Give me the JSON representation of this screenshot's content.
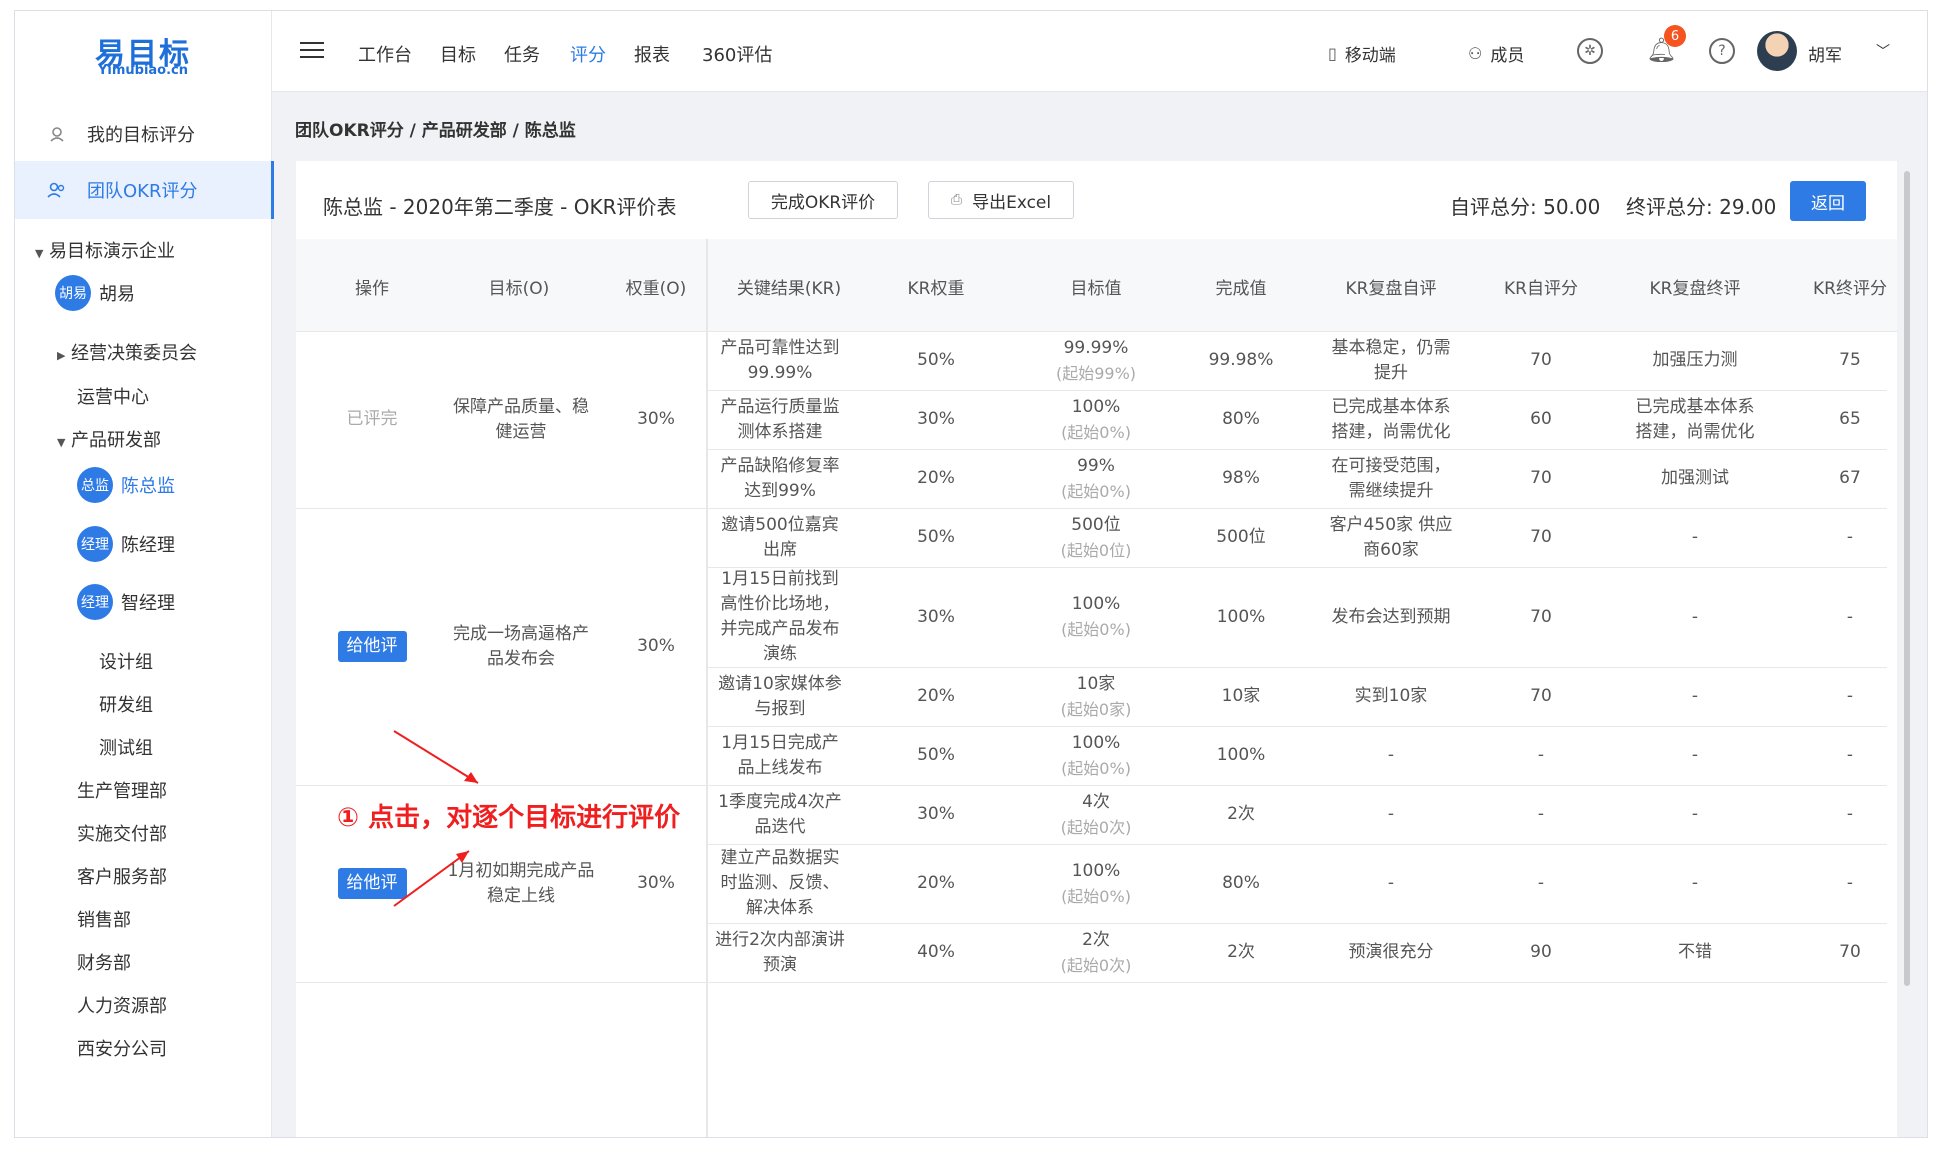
{
  "app": {
    "logo": "易目标",
    "logo_sub": "Yimubiao.cn"
  },
  "sidebar": {
    "my_score": "我的目标评分",
    "team_score": "团队OKR评分",
    "company": "易目标演示企业",
    "tree": [
      {
        "label": "胡易",
        "avatar": "胡易"
      },
      {
        "label": "经营决策委员会"
      },
      {
        "label": "运营中心"
      },
      {
        "label": "产品研发部"
      },
      {
        "label": "陈总监",
        "avatar": "总监"
      },
      {
        "label": "陈经理",
        "avatar": "经理"
      },
      {
        "label": "智经理",
        "avatar": "经理"
      },
      {
        "label": "设计组"
      },
      {
        "label": "研发组"
      },
      {
        "label": "测试组"
      },
      {
        "label": "生产管理部"
      },
      {
        "label": "实施交付部"
      },
      {
        "label": "客户服务部"
      },
      {
        "label": "销售部"
      },
      {
        "label": "财务部"
      },
      {
        "label": "人力资源部"
      },
      {
        "label": "西安分公司"
      }
    ]
  },
  "topnav": {
    "items": [
      "工作台",
      "目标",
      "任务",
      "评分",
      "报表",
      "360评估"
    ],
    "active": "评分"
  },
  "tools": {
    "mobile": "移动端",
    "members": "成员",
    "notifications": "6",
    "user": "胡军"
  },
  "breadcrumb": "团队OKR评分 / 产品研发部 / 陈总监",
  "card": {
    "title": "陈总监 - 2020年第二季度 - OKR评价表",
    "complete_btn": "完成OKR评价",
    "export_btn": "导出Excel",
    "self_total": "自评总分: 50.00",
    "final_total": "终评总分: 29.00",
    "back_btn": "返回"
  },
  "table": {
    "headers": [
      "操作",
      "目标(O)",
      "权重(O)",
      "关键结果(KR)",
      "KR权重",
      "目标值",
      "完成值",
      "KR复盘自评",
      "KR自评分",
      "KR复盘终评",
      "KR终评分"
    ],
    "objectives": [
      {
        "action": "已评完",
        "objective": "保障产品质量、稳健运营",
        "weight": "30%"
      },
      {
        "action": "给他评",
        "objective": "完成一场高逼格产品发布会",
        "weight": "30%"
      },
      {
        "action": "给他评",
        "objective": "1月初如期完成产品稳定上线",
        "weight": "30%"
      }
    ],
    "rows": [
      {
        "kr": "产品可靠性达到99.99%",
        "w": "50%",
        "target": "99.99%",
        "start": "(起始99%)",
        "done": "99.98%",
        "self": "基本稳定，仍需提升",
        "self_score": "70",
        "final": "加强压力测",
        "final_score": "75"
      },
      {
        "kr": "产品运行质量监测体系搭建",
        "w": "30%",
        "target": "100%",
        "start": "(起始0%)",
        "done": "80%",
        "self": "已完成基本体系搭建，尚需优化",
        "self_score": "60",
        "final": "已完成基本体系搭建，尚需优化",
        "final_score": "65"
      },
      {
        "kr": "产品缺陷修复率达到99%",
        "w": "20%",
        "target": "99%",
        "start": "(起始0%)",
        "done": "98%",
        "self": "在可接受范围，需继续提升",
        "self_score": "70",
        "final": "加强测试",
        "final_score": "67"
      },
      {
        "kr": "邀请500位嘉宾出席",
        "w": "50%",
        "target": "500位",
        "start": "(起始0位)",
        "done": "500位",
        "self": "客户450家 供应商60家",
        "self_score": "70",
        "final": "-",
        "final_score": "-"
      },
      {
        "kr": "1月15日前找到高性价比场地，并完成产品发布演练",
        "w": "30%",
        "target": "100%",
        "start": "(起始0%)",
        "done": "100%",
        "self": "发布会达到预期",
        "self_score": "70",
        "final": "-",
        "final_score": "-"
      },
      {
        "kr": "邀请10家媒体参与报到",
        "w": "20%",
        "target": "10家",
        "start": "(起始0家)",
        "done": "10家",
        "self": "实到10家",
        "self_score": "70",
        "final": "-",
        "final_score": "-"
      },
      {
        "kr": "1月15日完成产品上线发布",
        "w": "50%",
        "target": "100%",
        "start": "(起始0%)",
        "done": "100%",
        "self": "-",
        "self_score": "-",
        "final": "-",
        "final_score": "-"
      },
      {
        "kr": "1季度完成4次产品迭代",
        "w": "30%",
        "target": "4次",
        "start": "(起始0次)",
        "done": "2次",
        "self": "-",
        "self_score": "-",
        "final": "-",
        "final_score": "-"
      },
      {
        "kr": "建立产品数据实时监测、反馈、解决体系",
        "w": "20%",
        "target": "100%",
        "start": "(起始0%)",
        "done": "80%",
        "self": "-",
        "self_score": "-",
        "final": "-",
        "final_score": "-"
      },
      {
        "kr": "进行2次内部演讲预演",
        "w": "40%",
        "target": "2次",
        "start": "(起始0次)",
        "done": "2次",
        "self": "预演很充分",
        "self_score": "90",
        "final": "不错",
        "final_score": "70"
      }
    ]
  },
  "annotation": "① 点击，对逐个目标进行评价",
  "colors": {
    "primary": "#2e7be6",
    "annotation": "#f01f1f",
    "badge": "#f5531f"
  }
}
